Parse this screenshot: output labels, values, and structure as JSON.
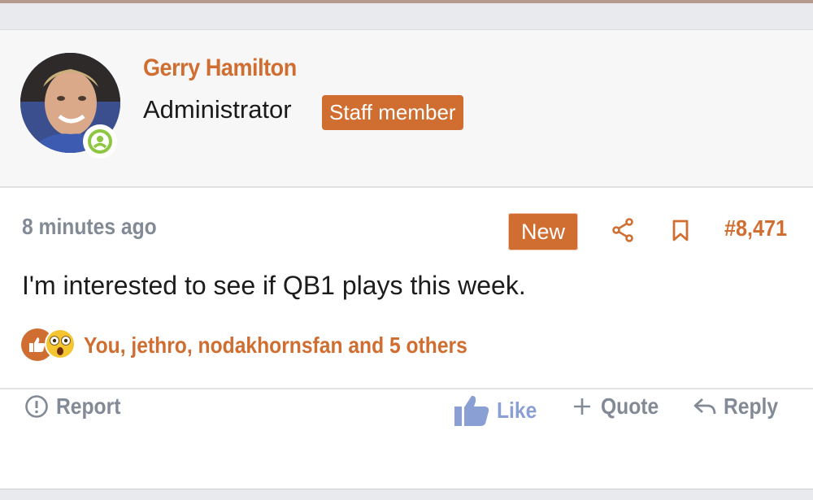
{
  "colors": {
    "accent": "#d06e31",
    "muted": "#828a96",
    "like": "#8aa0d4",
    "online": "#8dc63f"
  },
  "user": {
    "name": "Gerry Hamilton",
    "title": "Administrator",
    "badge": "Staff member",
    "status": "online"
  },
  "post": {
    "date": "8 minutes ago",
    "new_label": "New",
    "number": "#8,471",
    "body": "I'm interested to see if QB1 plays this week."
  },
  "reactions": {
    "icons": [
      "thumbs-up-icon",
      "astonished-emoji"
    ],
    "summary": "You, jethro, nodakhornsfan and 5 others"
  },
  "actions": {
    "report": "Report",
    "like": "Like",
    "quote": "Quote",
    "reply": "Reply"
  }
}
